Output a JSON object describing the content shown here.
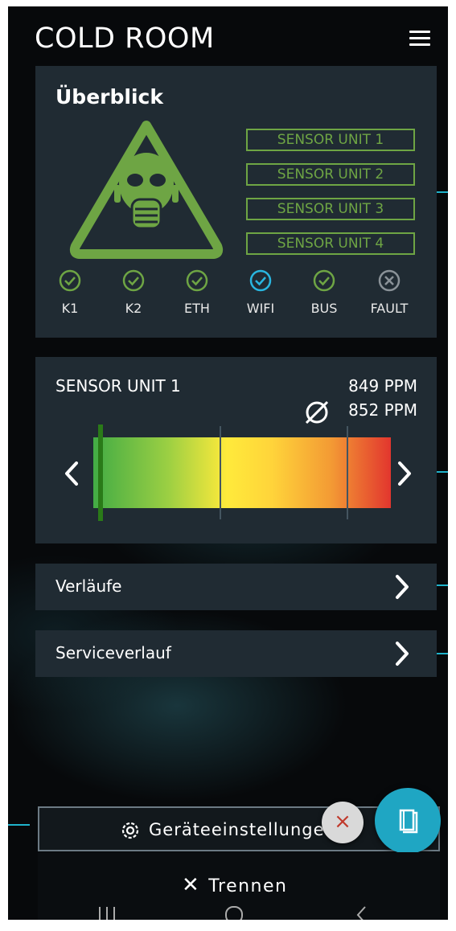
{
  "header": {
    "title": "COLD ROOM",
    "menu_icon": "menu-icon"
  },
  "overview": {
    "title": "Überblick",
    "hazard_icon": "gas-mask-warning-icon",
    "sensor_units": [
      "SENSOR UNIT 1",
      "SENSOR UNIT 2",
      "SENSOR UNIT 3",
      "SENSOR UNIT 4"
    ],
    "status": [
      {
        "label": "K1",
        "state": "ok",
        "color": "#6ea544"
      },
      {
        "label": "K2",
        "state": "ok",
        "color": "#6ea544"
      },
      {
        "label": "ETH",
        "state": "ok",
        "color": "#6ea544"
      },
      {
        "label": "WIFI",
        "state": "ok",
        "color": "#29b6e0"
      },
      {
        "label": "BUS",
        "state": "ok",
        "color": "#6ea544"
      },
      {
        "label": "FAULT",
        "state": "inactive",
        "color": "#8a9298"
      }
    ]
  },
  "sensor": {
    "name": "SENSOR UNIT 1",
    "current": "849 PPM",
    "average": "852 PPM",
    "average_icon": "average-icon"
  },
  "nav": {
    "history": "Verläufe",
    "service_history": "Serviceverlauf"
  },
  "bottom": {
    "settings": "Geräteeinstellungen",
    "disconnect": "Trennen",
    "close_fab": "×",
    "book_fab_icon": "book-icon"
  },
  "colors": {
    "accent_green": "#6ea544",
    "accent_cyan": "#1fa6c3",
    "card_bg": "#202b33"
  }
}
